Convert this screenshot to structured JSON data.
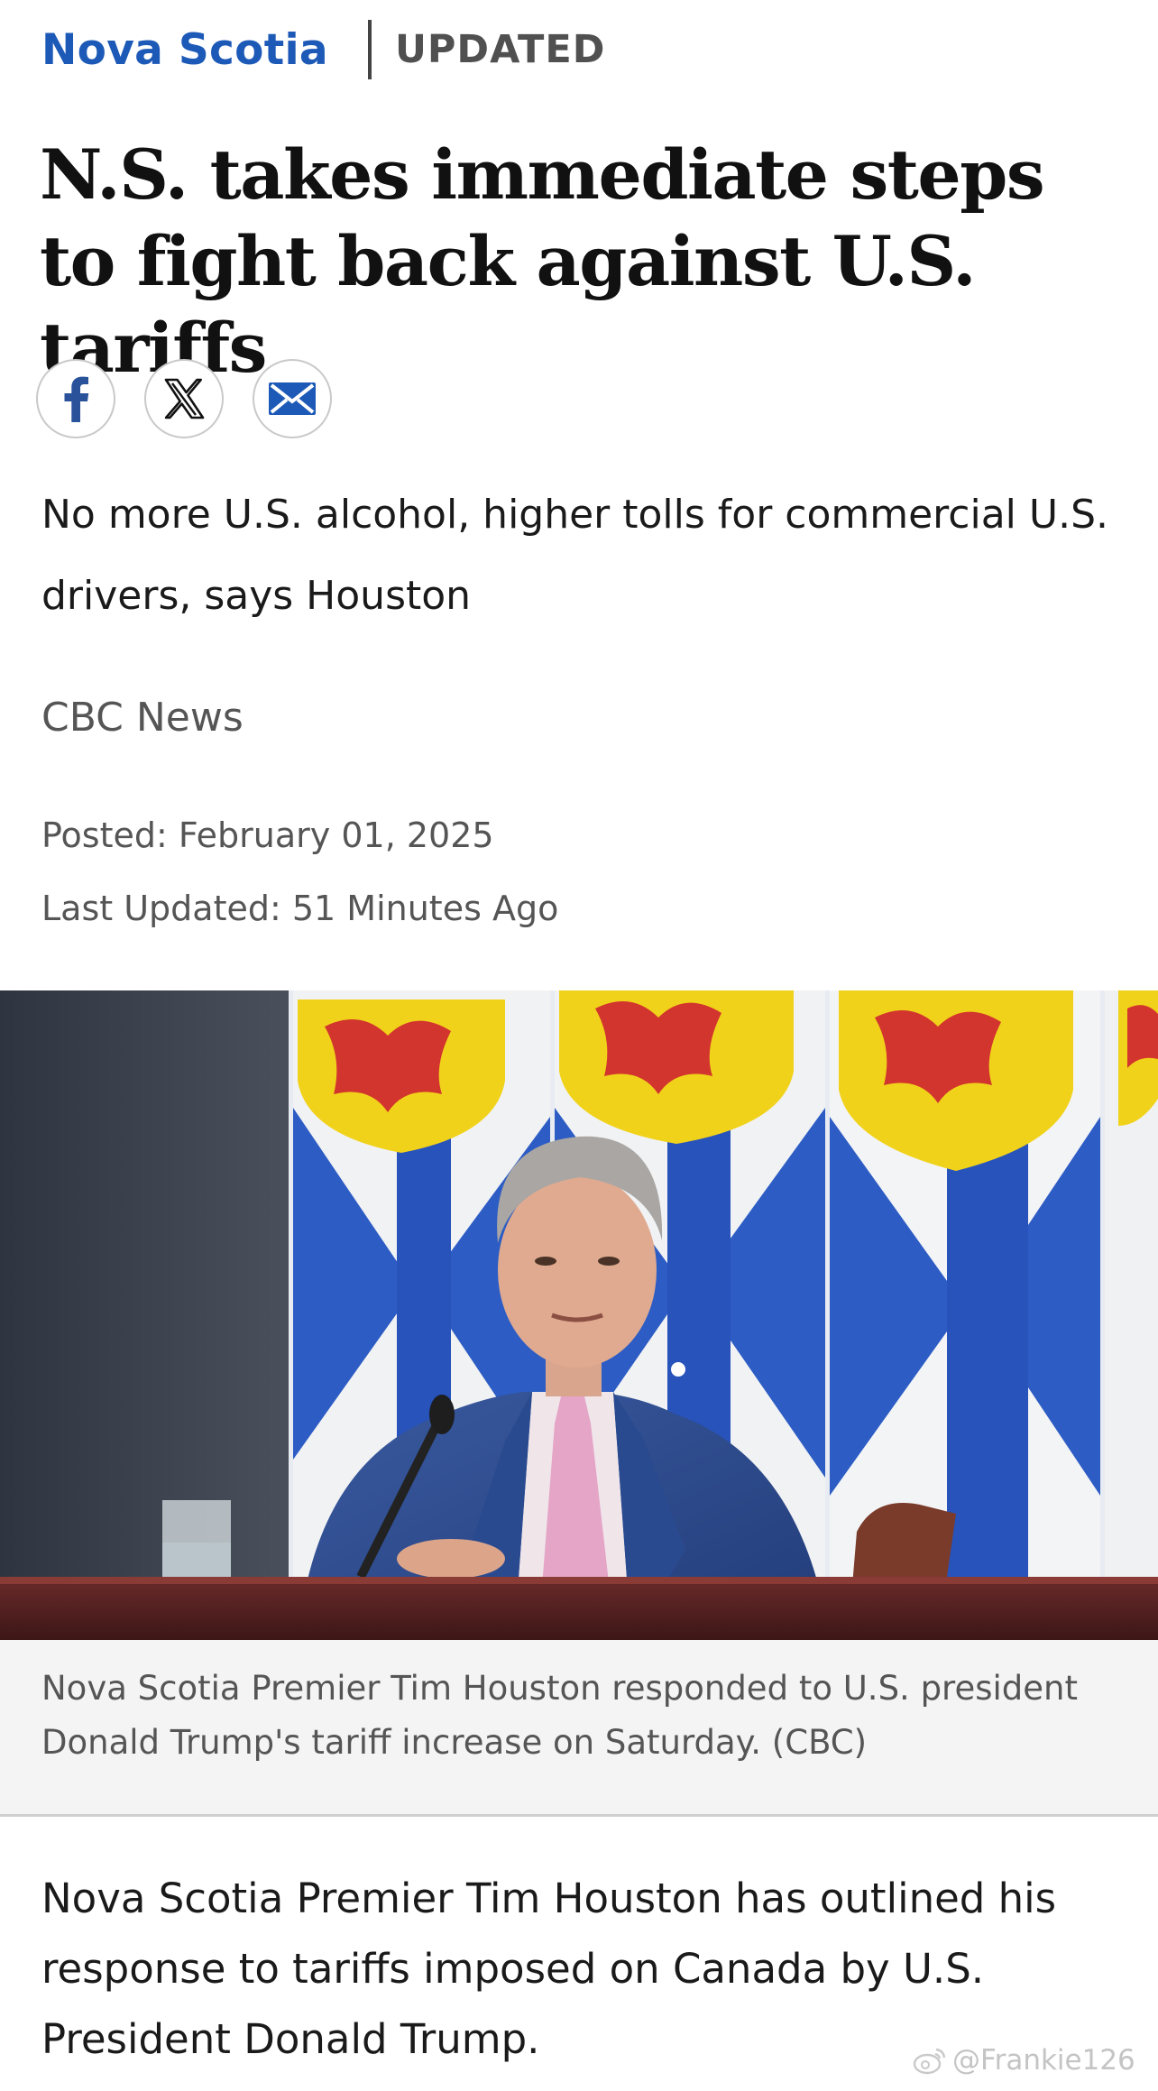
{
  "header": {
    "section": "Nova Scotia",
    "status": "UPDATED"
  },
  "article": {
    "headline": "N.S. takes immediate steps to fight back against U.S. tariffs",
    "deck": "No more U.S. alcohol, higher tolls for commercial U.S. drivers, says Houston",
    "byline": "CBC News",
    "posted": "Posted: February 01, 2025",
    "last_updated": "Last Updated: 51 Minutes Ago",
    "photo_caption": "Nova Scotia Premier Tim Houston responded to U.S. president Donald Trump's tariff increase on Saturday. (CBC)",
    "body_first_paragraph": "Nova Scotia Premier Tim Houston has outlined his response to tariffs imposed on Canada by U.S. President Donald Trump."
  },
  "share": {
    "icons": [
      "facebook-icon",
      "x-icon",
      "email-icon"
    ]
  },
  "watermark": {
    "text": "@Frankie126"
  },
  "colors": {
    "section_blue": "#1d59b7",
    "headline": "#111111",
    "meta_gray": "#555555"
  }
}
